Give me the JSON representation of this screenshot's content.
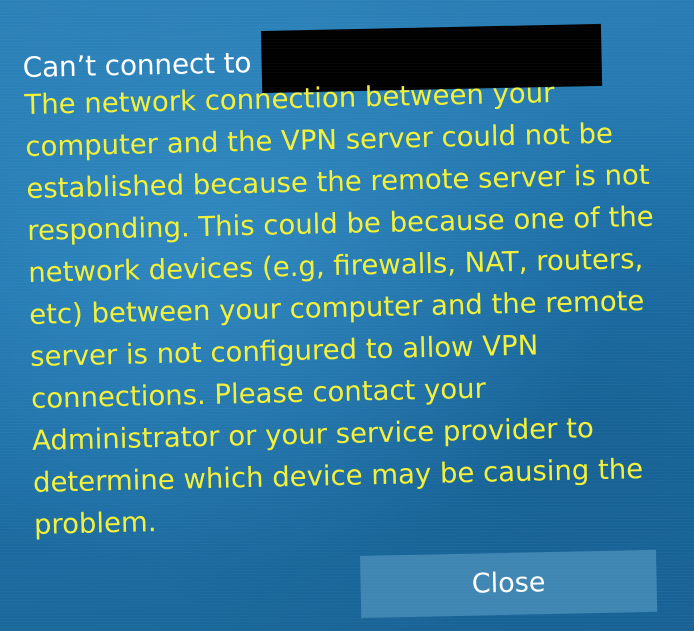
{
  "dialog": {
    "title": "Can’t connect to",
    "message_lines": [
      "The network connection between your",
      "computer and the VPN server could not be",
      "established because the remote server is not",
      "responding. This could be because one of the",
      "network devices (e.g, firewalls, NAT, routers,",
      "etc) between your computer and the remote",
      "server is not configured to allow VPN",
      "connections. Please contact your",
      "Administrator or your service provider to",
      "determine which device may be causing the",
      "problem."
    ],
    "close_label": "Close"
  },
  "colors": {
    "background": "#1f74ac",
    "title_text": "#ffffff",
    "message_text": "#f3f03a",
    "button_background": "#3f86b3",
    "redaction": "#000000"
  }
}
